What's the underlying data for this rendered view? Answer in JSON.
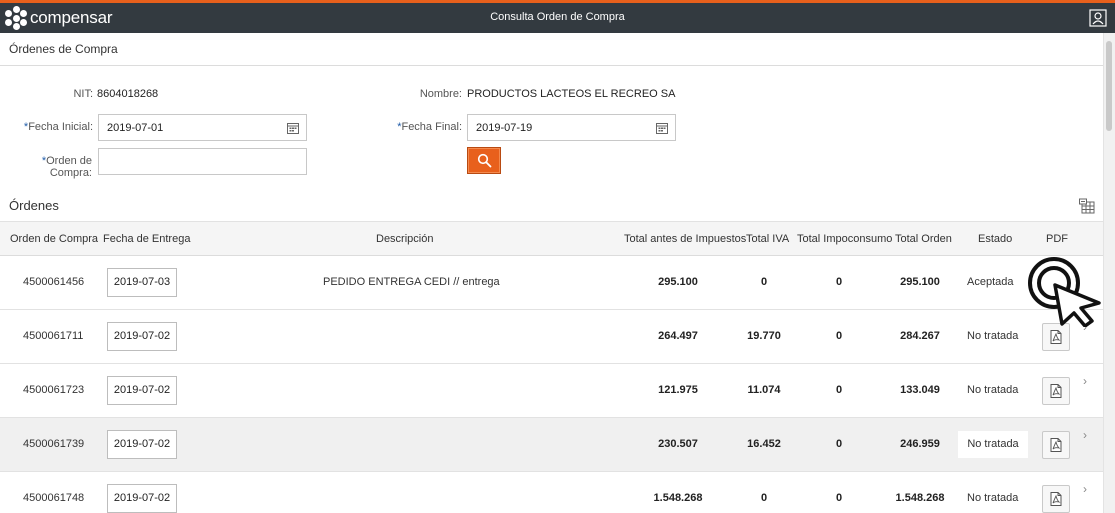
{
  "header": {
    "brand": "compensar",
    "title": "Consulta Orden de Compra"
  },
  "page": {
    "title": "Órdenes de Compra"
  },
  "form": {
    "nit_label": "NIT:",
    "nit_value": "8604018268",
    "nombre_label": "Nombre:",
    "nombre_value": "PRODUCTOS LACTEOS EL RECREO SA",
    "required_mark": "*",
    "fecha_inicial_label": "Fecha Inicial:",
    "fecha_inicial_value": "2019-07-01",
    "fecha_final_label": "Fecha Final:",
    "fecha_final_value": "2019-07-19",
    "orden_label_1": "Orden de",
    "orden_label_2": "Compra:",
    "orden_value": ""
  },
  "section": {
    "title": "Órdenes"
  },
  "table": {
    "columns": [
      "Orden de Compra",
      "Fecha de Entrega",
      "Descripción",
      "Total antes de Impuestos",
      "Total IVA",
      "Total Impoconsumo",
      "Total Orden",
      "Estado",
      "PDF"
    ],
    "rows": [
      {
        "orden": "4500061456",
        "fecha": "2019-07-03",
        "descripcion": "PEDIDO ENTREGA CEDI // entrega",
        "antes": "295.100",
        "iva": "0",
        "impoconsumo": "0",
        "total": "295.100",
        "estado": "Aceptada"
      },
      {
        "orden": "4500061711",
        "fecha": "2019-07-02",
        "descripcion": "",
        "antes": "264.497",
        "iva": "19.770",
        "impoconsumo": "0",
        "total": "284.267",
        "estado": "No tratada"
      },
      {
        "orden": "4500061723",
        "fecha": "2019-07-02",
        "descripcion": "",
        "antes": "121.975",
        "iva": "11.074",
        "impoconsumo": "0",
        "total": "133.049",
        "estado": "No tratada"
      },
      {
        "orden": "4500061739",
        "fecha": "2019-07-02",
        "descripcion": "",
        "antes": "230.507",
        "iva": "16.452",
        "impoconsumo": "0",
        "total": "246.959",
        "estado": "No tratada"
      },
      {
        "orden": "4500061748",
        "fecha": "2019-07-02",
        "descripcion": "",
        "antes": "1.548.268",
        "iva": "0",
        "impoconsumo": "0",
        "total": "1.548.268",
        "estado": "No tratada"
      }
    ]
  },
  "colors": {
    "accent": "#e8601c",
    "topbar": "#333a40",
    "required": "#1f5ba8"
  },
  "icons": {
    "user": "user-profile-icon",
    "calendar": "calendar-icon",
    "search": "search-icon",
    "export": "export-table-icon",
    "pdf": "pdf-icon",
    "chevron": "chevron-right-icon",
    "cursor": "click-cursor-icon"
  }
}
